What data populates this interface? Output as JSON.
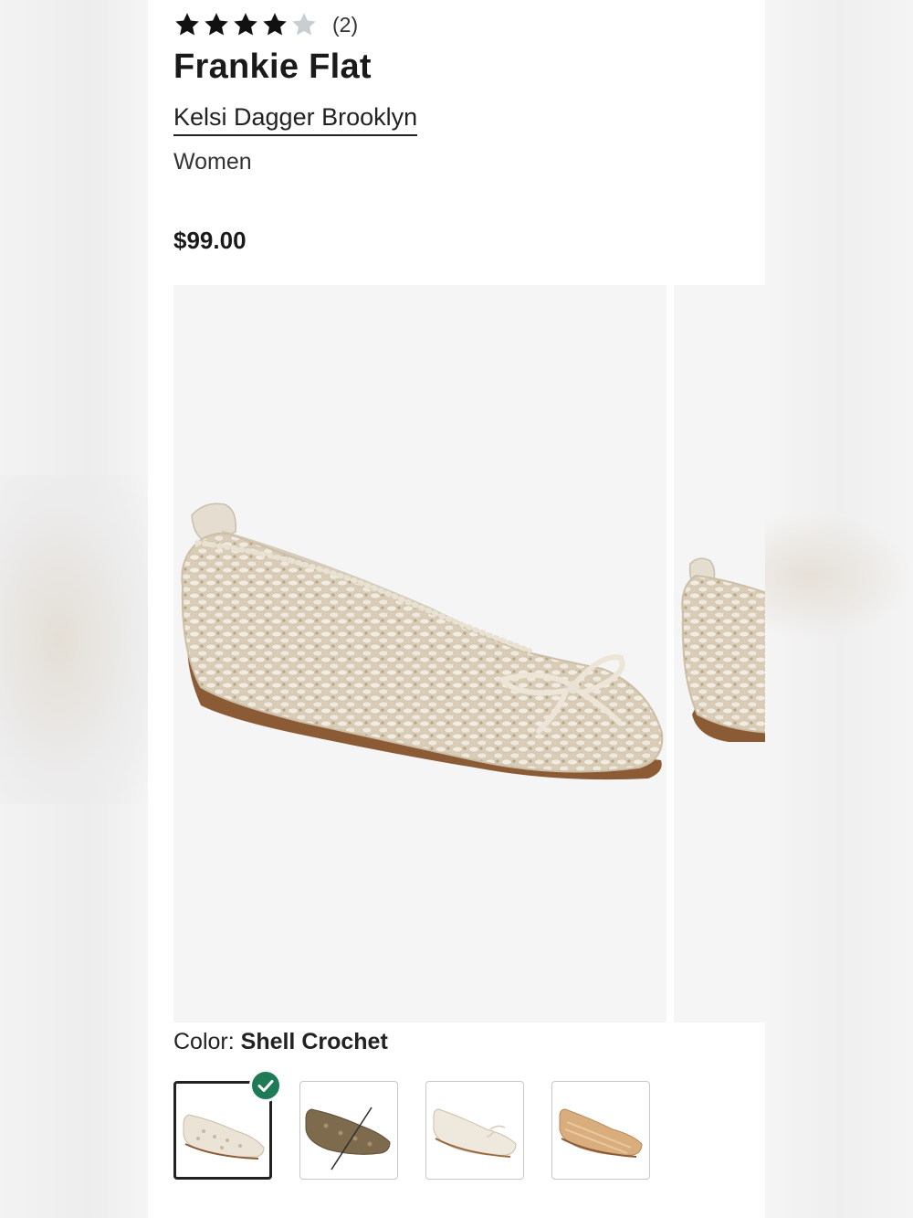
{
  "product": {
    "rating": 4,
    "rating_max": 5,
    "review_count": "(2)",
    "title": "Frankie Flat",
    "brand": "Kelsi Dagger Brooklyn",
    "category": "Women",
    "price": "$99.00"
  },
  "color": {
    "label": "Color:",
    "selected": "Shell Crochet"
  },
  "swatches": [
    {
      "icon": "shoe-shell-crochet",
      "selected": true,
      "available": true
    },
    {
      "icon": "shoe-brown-crochet",
      "selected": false,
      "available": false
    },
    {
      "icon": "shoe-cream-stripe",
      "selected": false,
      "available": true
    },
    {
      "icon": "shoe-tan-stripe",
      "selected": false,
      "available": true
    }
  ],
  "colors": {
    "star_filled": "#111111",
    "star_empty": "#c9ced3",
    "check_badge": "#1e7b55",
    "image_bg": "#f5f5f5"
  }
}
